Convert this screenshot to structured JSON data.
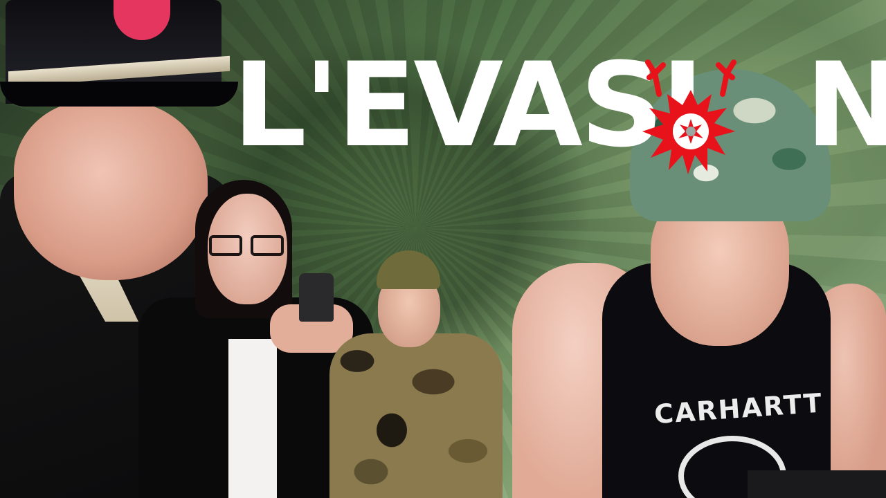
{
  "title": {
    "before_o": "L'EVASI",
    "o_replacement": "explosion-icon",
    "after_o": "N",
    "color": "#ffffff",
    "accent": "#e8121b"
  },
  "figures": {
    "right_shirt_text": "CARHARTT"
  }
}
